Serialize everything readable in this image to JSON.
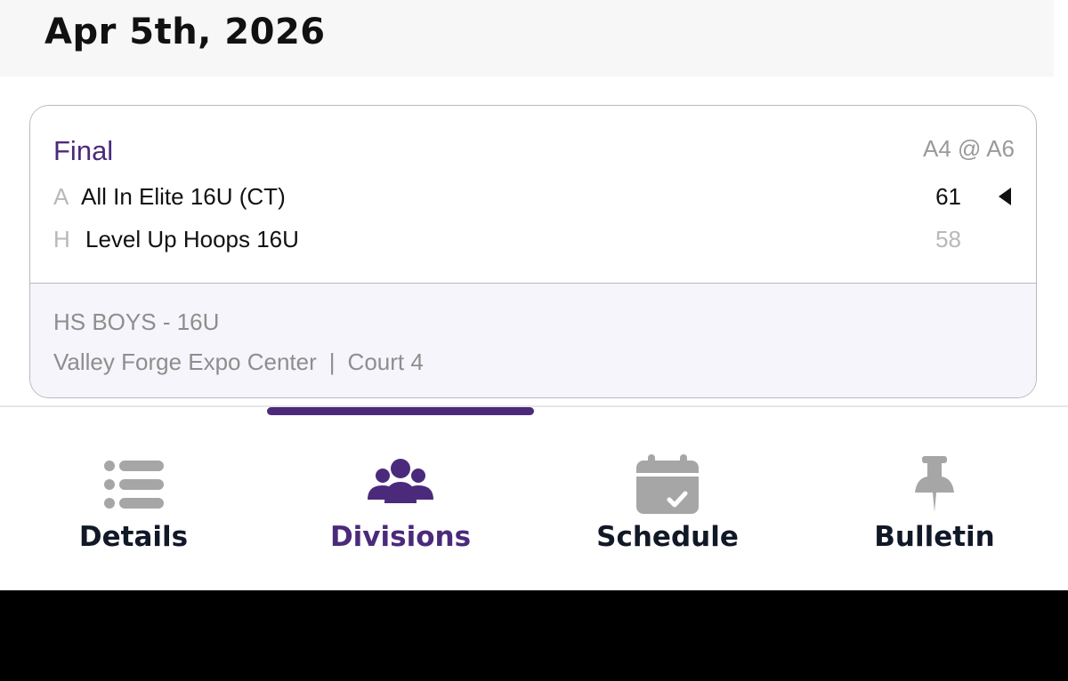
{
  "header": {
    "date": "Apr 5th, 2026"
  },
  "game": {
    "status": "Final",
    "matchup_code": "A4 @ A6",
    "away": {
      "side": "A",
      "name": "All In Elite 16U (CT)",
      "score": "61",
      "winner": true
    },
    "home": {
      "side": "H",
      "name": "Level Up Hoops 16U",
      "score": "58",
      "winner": false
    },
    "division": "HS BOYS - 16U",
    "venue": "Valley Forge Expo Center",
    "venue_separator": "|",
    "court": "Court 4"
  },
  "tabs": [
    {
      "label": "Details",
      "icon": "list-icon",
      "active": false
    },
    {
      "label": "Divisions",
      "icon": "users-icon",
      "active": true
    },
    {
      "label": "Schedule",
      "icon": "calendar-check-icon",
      "active": false
    },
    {
      "label": "Bulletin",
      "icon": "pushpin-icon",
      "active": false
    }
  ],
  "colors": {
    "accent": "#4b2a7b",
    "muted_text": "#8e8e8e",
    "inactive_icon": "#a6a6a6",
    "tab_label": "#111827",
    "card_footer_bg": "#f5f5fb"
  }
}
